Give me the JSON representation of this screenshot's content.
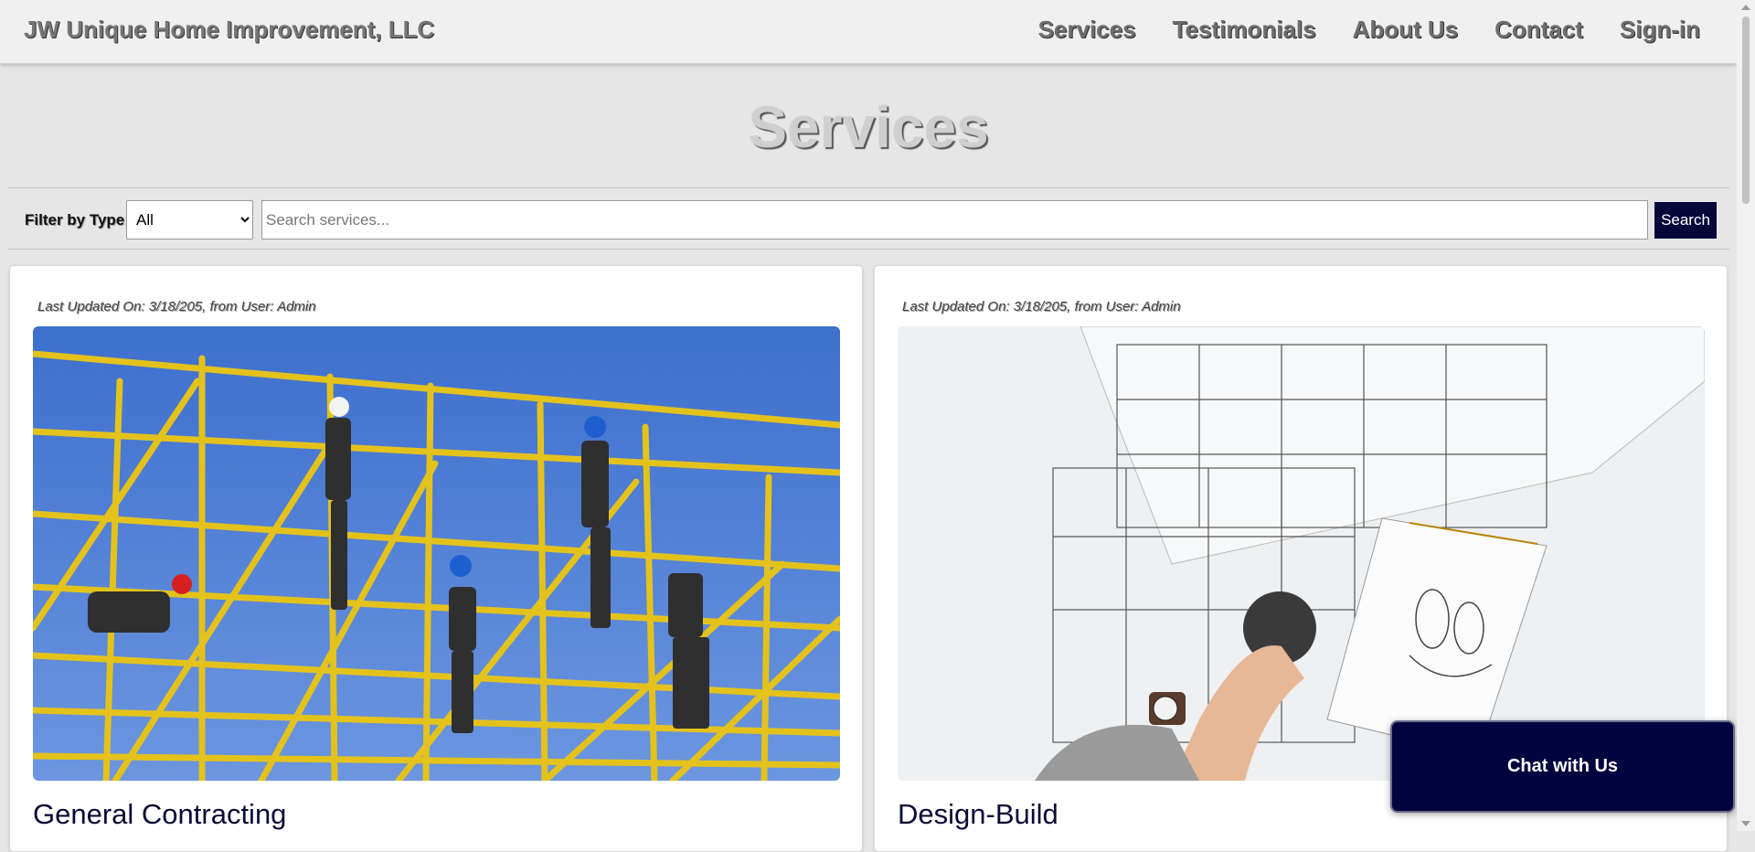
{
  "nav": {
    "brand": "JW Unique Home Improvement, LLC",
    "links": [
      "Services",
      "Testimonials",
      "About Us",
      "Contact",
      "Sign-in"
    ]
  },
  "page": {
    "title": "Services"
  },
  "filter": {
    "label": "Filter by Type:",
    "selected": "All",
    "search_placeholder": "Search services...",
    "search_button": "Search"
  },
  "cards": [
    {
      "meta": "Last Updated On: 3/18/205, from User: Admin",
      "title": "General Contracting"
    },
    {
      "meta": "Last Updated On: 3/18/205, from User: Admin",
      "title": "Design-Build"
    }
  ],
  "chat": {
    "label": "Chat with Us"
  },
  "colors": {
    "accent": "#06063a",
    "chat_bg": "#03033f"
  }
}
